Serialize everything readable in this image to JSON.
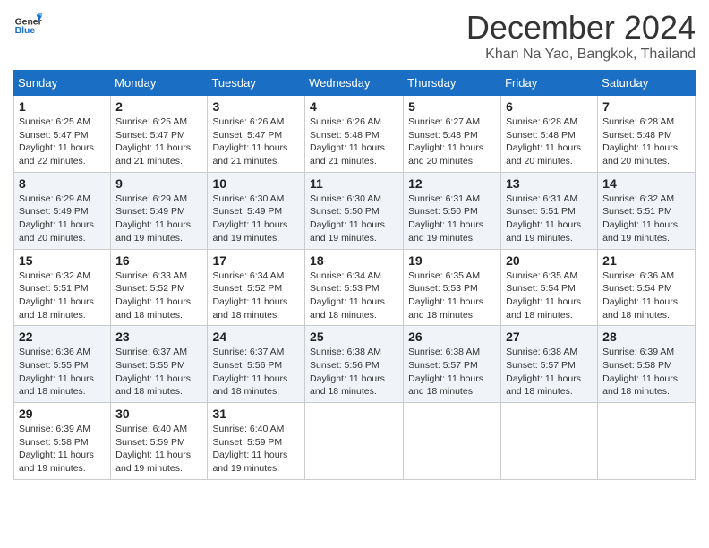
{
  "header": {
    "logo_general": "General",
    "logo_blue": "Blue",
    "month_title": "December 2024",
    "location": "Khan Na Yao, Bangkok, Thailand"
  },
  "days_of_week": [
    "Sunday",
    "Monday",
    "Tuesday",
    "Wednesday",
    "Thursday",
    "Friday",
    "Saturday"
  ],
  "weeks": [
    [
      {
        "day": "1",
        "sunrise": "6:25 AM",
        "sunset": "5:47 PM",
        "daylight": "11 hours and 22 minutes."
      },
      {
        "day": "2",
        "sunrise": "6:25 AM",
        "sunset": "5:47 PM",
        "daylight": "11 hours and 21 minutes."
      },
      {
        "day": "3",
        "sunrise": "6:26 AM",
        "sunset": "5:47 PM",
        "daylight": "11 hours and 21 minutes."
      },
      {
        "day": "4",
        "sunrise": "6:26 AM",
        "sunset": "5:48 PM",
        "daylight": "11 hours and 21 minutes."
      },
      {
        "day": "5",
        "sunrise": "6:27 AM",
        "sunset": "5:48 PM",
        "daylight": "11 hours and 20 minutes."
      },
      {
        "day": "6",
        "sunrise": "6:28 AM",
        "sunset": "5:48 PM",
        "daylight": "11 hours and 20 minutes."
      },
      {
        "day": "7",
        "sunrise": "6:28 AM",
        "sunset": "5:48 PM",
        "daylight": "11 hours and 20 minutes."
      }
    ],
    [
      {
        "day": "8",
        "sunrise": "6:29 AM",
        "sunset": "5:49 PM",
        "daylight": "11 hours and 20 minutes."
      },
      {
        "day": "9",
        "sunrise": "6:29 AM",
        "sunset": "5:49 PM",
        "daylight": "11 hours and 19 minutes."
      },
      {
        "day": "10",
        "sunrise": "6:30 AM",
        "sunset": "5:49 PM",
        "daylight": "11 hours and 19 minutes."
      },
      {
        "day": "11",
        "sunrise": "6:30 AM",
        "sunset": "5:50 PM",
        "daylight": "11 hours and 19 minutes."
      },
      {
        "day": "12",
        "sunrise": "6:31 AM",
        "sunset": "5:50 PM",
        "daylight": "11 hours and 19 minutes."
      },
      {
        "day": "13",
        "sunrise": "6:31 AM",
        "sunset": "5:51 PM",
        "daylight": "11 hours and 19 minutes."
      },
      {
        "day": "14",
        "sunrise": "6:32 AM",
        "sunset": "5:51 PM",
        "daylight": "11 hours and 19 minutes."
      }
    ],
    [
      {
        "day": "15",
        "sunrise": "6:32 AM",
        "sunset": "5:51 PM",
        "daylight": "11 hours and 18 minutes."
      },
      {
        "day": "16",
        "sunrise": "6:33 AM",
        "sunset": "5:52 PM",
        "daylight": "11 hours and 18 minutes."
      },
      {
        "day": "17",
        "sunrise": "6:34 AM",
        "sunset": "5:52 PM",
        "daylight": "11 hours and 18 minutes."
      },
      {
        "day": "18",
        "sunrise": "6:34 AM",
        "sunset": "5:53 PM",
        "daylight": "11 hours and 18 minutes."
      },
      {
        "day": "19",
        "sunrise": "6:35 AM",
        "sunset": "5:53 PM",
        "daylight": "11 hours and 18 minutes."
      },
      {
        "day": "20",
        "sunrise": "6:35 AM",
        "sunset": "5:54 PM",
        "daylight": "11 hours and 18 minutes."
      },
      {
        "day": "21",
        "sunrise": "6:36 AM",
        "sunset": "5:54 PM",
        "daylight": "11 hours and 18 minutes."
      }
    ],
    [
      {
        "day": "22",
        "sunrise": "6:36 AM",
        "sunset": "5:55 PM",
        "daylight": "11 hours and 18 minutes."
      },
      {
        "day": "23",
        "sunrise": "6:37 AM",
        "sunset": "5:55 PM",
        "daylight": "11 hours and 18 minutes."
      },
      {
        "day": "24",
        "sunrise": "6:37 AM",
        "sunset": "5:56 PM",
        "daylight": "11 hours and 18 minutes."
      },
      {
        "day": "25",
        "sunrise": "6:38 AM",
        "sunset": "5:56 PM",
        "daylight": "11 hours and 18 minutes."
      },
      {
        "day": "26",
        "sunrise": "6:38 AM",
        "sunset": "5:57 PM",
        "daylight": "11 hours and 18 minutes."
      },
      {
        "day": "27",
        "sunrise": "6:38 AM",
        "sunset": "5:57 PM",
        "daylight": "11 hours and 18 minutes."
      },
      {
        "day": "28",
        "sunrise": "6:39 AM",
        "sunset": "5:58 PM",
        "daylight": "11 hours and 18 minutes."
      }
    ],
    [
      {
        "day": "29",
        "sunrise": "6:39 AM",
        "sunset": "5:58 PM",
        "daylight": "11 hours and 19 minutes."
      },
      {
        "day": "30",
        "sunrise": "6:40 AM",
        "sunset": "5:59 PM",
        "daylight": "11 hours and 19 minutes."
      },
      {
        "day": "31",
        "sunrise": "6:40 AM",
        "sunset": "5:59 PM",
        "daylight": "11 hours and 19 minutes."
      },
      null,
      null,
      null,
      null
    ]
  ]
}
